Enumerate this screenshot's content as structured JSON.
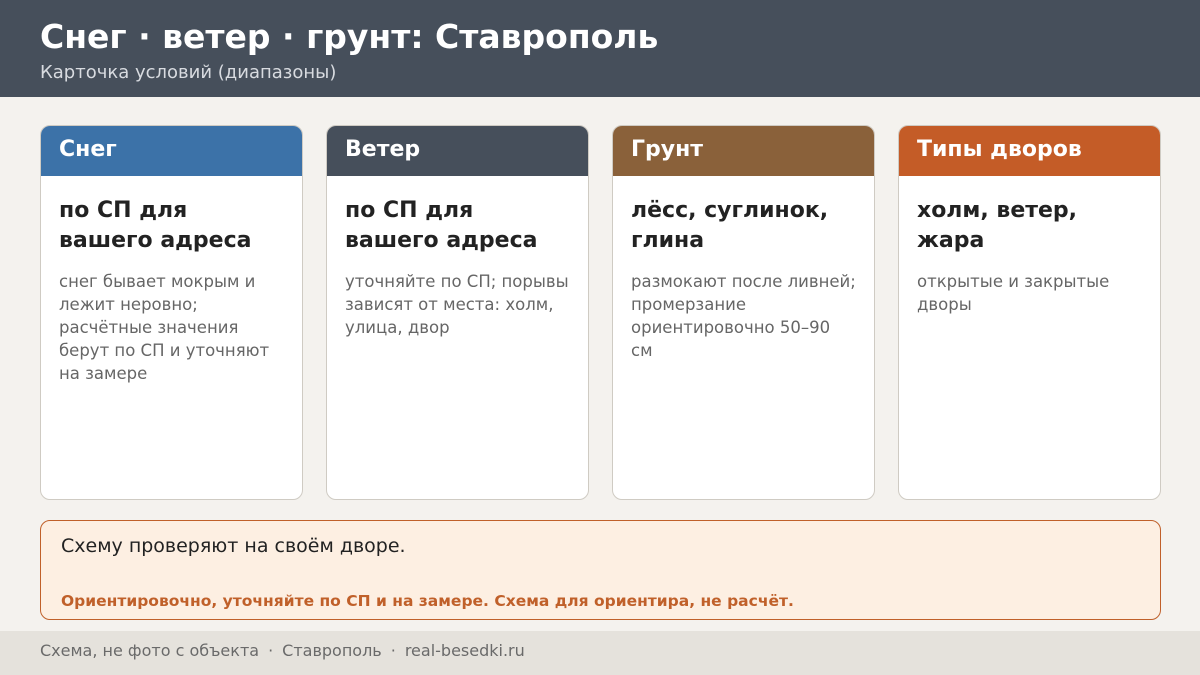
{
  "header": {
    "title": "Снег · ветер · грунт: Ставрополь",
    "subtitle": "Карточка условий (диапазоны)"
  },
  "cards": [
    {
      "heading": "Снег",
      "value": "по СП для вашего адреса",
      "note": "снег бывает мокрым и лежит неровно; расчётные значения берут по СП и уточняют на замере",
      "color": "#3c72a8"
    },
    {
      "heading": "Ветер",
      "value": "по СП для вашего адреса",
      "note": "уточняйте по СП; порывы зависят от места: холм, улица, двор",
      "color": "#464f5b"
    },
    {
      "heading": "Грунт",
      "value": "лёсс, суглинок, глина",
      "note": "размокают после ливней; промерзание ориентировочно 50–90 см",
      "color": "#8a613a"
    },
    {
      "heading": "Типы дворов",
      "value": "холм, ветер, жара",
      "note": "открытые и закрытые дворы",
      "color": "#c45c27"
    }
  ],
  "note": {
    "main": "Схему проверяют на своём дворе.",
    "warning": "Ориентировочно, уточняйте по СП и на замере. Схема для ориентира, не расчёт."
  },
  "footer": {
    "parts": [
      "Схема, не фото с объекта",
      "Ставрополь",
      "real-besedki.ru"
    ],
    "separator": "·"
  }
}
